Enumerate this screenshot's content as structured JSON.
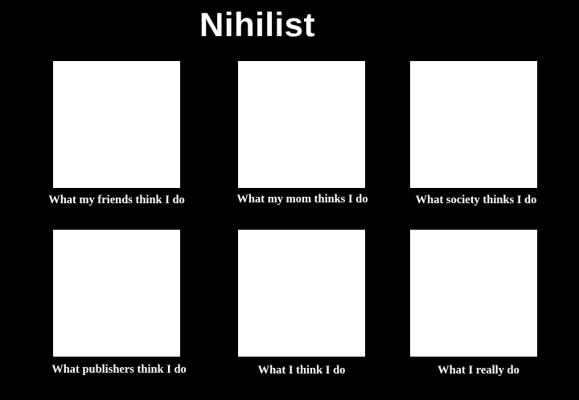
{
  "title": "Nihilist",
  "panels": [
    {
      "caption": "What my friends think I do"
    },
    {
      "caption": "What my mom thinks I do"
    },
    {
      "caption": "What society thinks I do"
    },
    {
      "caption": "What publishers think I do"
    },
    {
      "caption": "What I think I do"
    },
    {
      "caption": "What I really do"
    }
  ],
  "colors": {
    "background": "#000000",
    "panel": "#ffffff",
    "text": "#ffffff"
  }
}
